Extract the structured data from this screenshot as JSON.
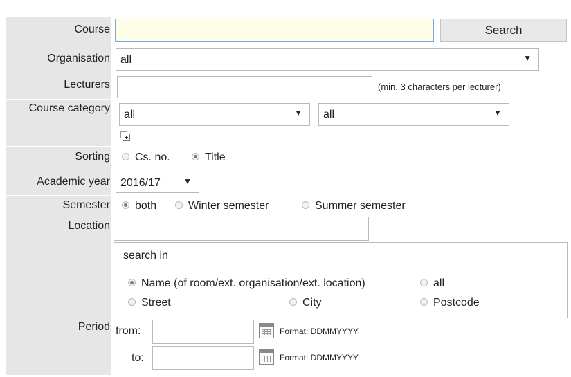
{
  "labels": {
    "course": "Course",
    "organisation": "Organisation",
    "lecturers": "Lecturers",
    "course_category": "Course category",
    "sorting": "Sorting",
    "academic_year": "Academic year",
    "semester": "Semester",
    "location": "Location",
    "period": "Period"
  },
  "course": {
    "value": "",
    "search_label": "Search"
  },
  "organisation": {
    "selected": "all"
  },
  "lecturers": {
    "value": "",
    "hint": "(min. 3 characters per lecturer)"
  },
  "course_category": {
    "select1": "all",
    "select2": "all"
  },
  "sorting": {
    "options": [
      {
        "label": "Cs. no.",
        "checked": false
      },
      {
        "label": "Title",
        "checked": true
      }
    ]
  },
  "academic_year": {
    "selected": "2016/17"
  },
  "semester": {
    "options": [
      {
        "label": "both",
        "checked": true
      },
      {
        "label": "Winter semester",
        "checked": false
      },
      {
        "label": "Summer semester",
        "checked": false
      }
    ]
  },
  "location": {
    "value": "",
    "search_in_label": "search in",
    "options": [
      {
        "label": "Name (of room/ext. organisation/ext. location)",
        "checked": true
      },
      {
        "label": "all",
        "checked": false
      },
      {
        "label": "Street",
        "checked": false
      },
      {
        "label": "City",
        "checked": false
      },
      {
        "label": "Postcode",
        "checked": false
      }
    ]
  },
  "period": {
    "from_label": "from:",
    "to_label": "to:",
    "from_value": "",
    "to_value": "",
    "format_hint": "Format: DDMMYYYY"
  },
  "icons": {
    "expand": "expand-plus-icon",
    "calendar": "calendar-icon"
  },
  "colors": {
    "label_bg": "#e6e6e6",
    "course_input_bg": "#fdfde8",
    "focus_border": "#7fa6d6"
  }
}
